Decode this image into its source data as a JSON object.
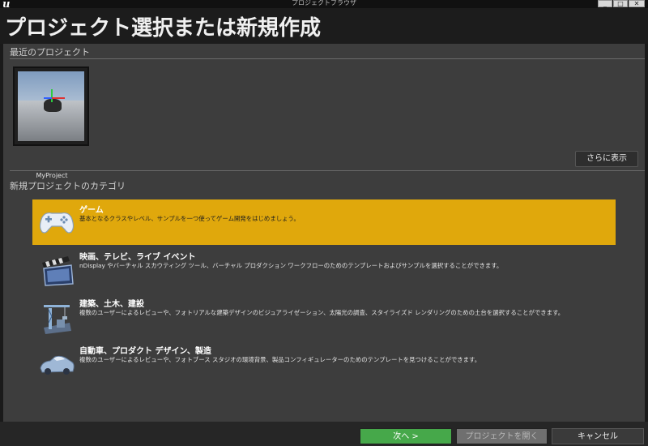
{
  "window": {
    "title": "プロジェクトブラウザ",
    "logo": "u",
    "controls": [
      "_",
      "□",
      "✕"
    ]
  },
  "header": {
    "title": "プロジェクト選択または新規作成"
  },
  "recent": {
    "label": "最近のプロジェクト",
    "projects": [
      {
        "name": "MyProject"
      }
    ],
    "more_label": "さらに表示"
  },
  "new_project": {
    "label": "新規プロジェクトのカテゴリ",
    "categories": [
      {
        "title": "ゲーム",
        "description": "基本となるクラスやレベル、サンプルを一つ使ってゲーム開発をはじめましょう。",
        "icon": "gamepad-icon",
        "selected": true
      },
      {
        "title": "映画、テレビ、ライブ イベント",
        "description": "nDisplay やバーチャル スカウティング ツール、バーチャル プロダクション ワークフローのためのテンプレートおよびサンプルを選択することができます。",
        "icon": "clapperboard-icon",
        "selected": false
      },
      {
        "title": "建築、土木、建設",
        "description": "複数のユーザーによるレビューや、フォトリアルな建築デザインのビジュアライゼーション、太陽光の調査、スタイライズド レンダリングのための土台を選択することができます。",
        "icon": "crane-icon",
        "selected": false
      },
      {
        "title": "自動車、プロダクト デザイン、製造",
        "description": "複数のユーザーによるレビューや、フォトブース スタジオの環境背景、製品コンフィギュレーターのためのテンプレートを見つけることができます。",
        "icon": "car-icon",
        "selected": false
      }
    ]
  },
  "footer": {
    "next_label": "次へ >",
    "open_label": "プロジェクトを開く",
    "cancel_label": "キャンセル"
  },
  "colors": {
    "selected_category": "#e0a80c",
    "next_button": "#46a84a",
    "panel": "#3d3d3d"
  }
}
